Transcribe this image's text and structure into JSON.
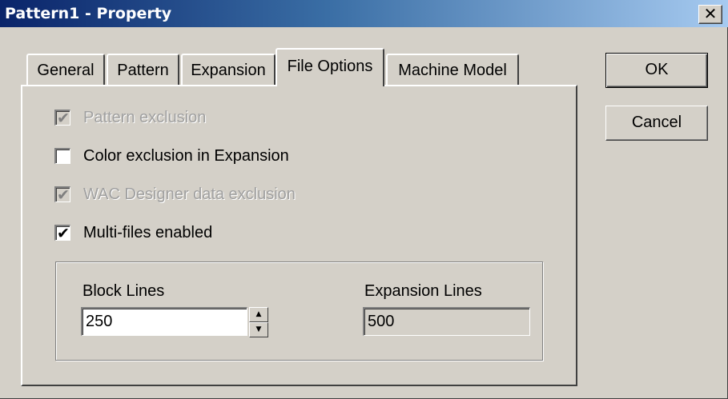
{
  "window": {
    "title": "Pattern1 - Property",
    "close_glyph": "✕"
  },
  "tabs": [
    {
      "label": "General",
      "active": false
    },
    {
      "label": "Pattern",
      "active": false
    },
    {
      "label": "Expansion",
      "active": false
    },
    {
      "label": "File Options",
      "active": true
    },
    {
      "label": "Machine Model",
      "active": false
    }
  ],
  "buttons": {
    "ok": "OK",
    "cancel": "Cancel"
  },
  "options": [
    {
      "label": "Pattern exclusion",
      "checked": true,
      "enabled": false
    },
    {
      "label": "Color exclusion in Expansion",
      "checked": false,
      "enabled": true
    },
    {
      "label": "WAC Designer data exclusion",
      "checked": true,
      "enabled": false
    },
    {
      "label": "Multi-files enabled",
      "checked": true,
      "enabled": true
    }
  ],
  "block_lines": {
    "label": "Block Lines",
    "value": "250"
  },
  "expansion_lines": {
    "label": "Expansion Lines",
    "value": "500"
  },
  "icons": {
    "check": "✔",
    "spin_up": "▲",
    "spin_down": "▼"
  }
}
